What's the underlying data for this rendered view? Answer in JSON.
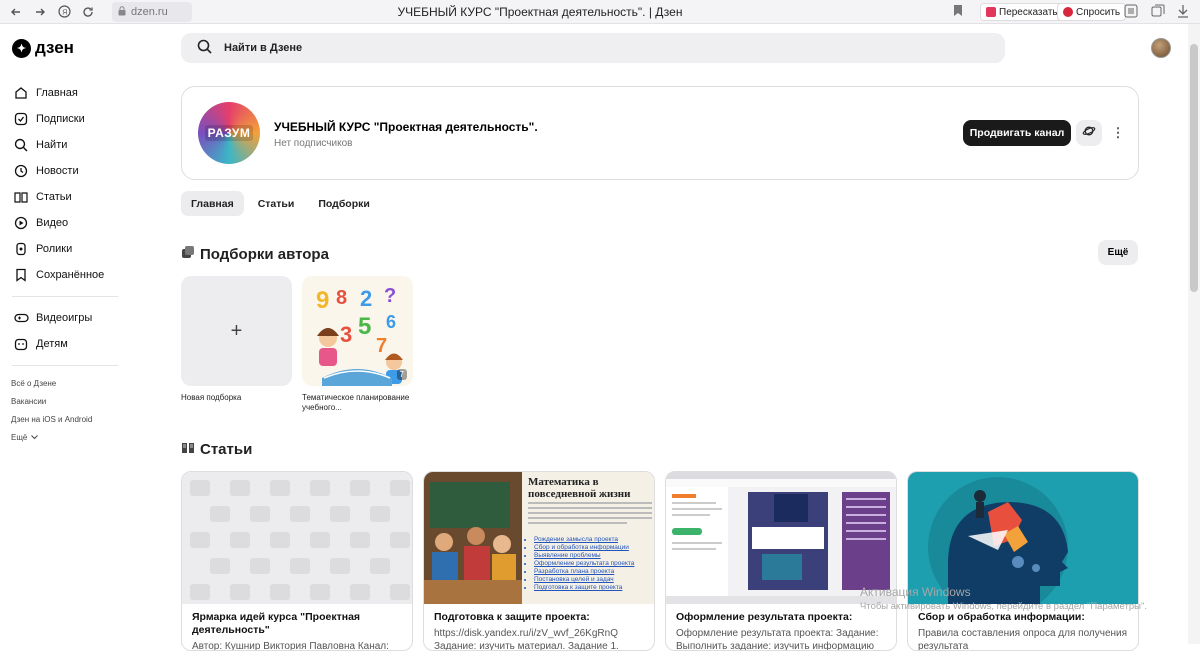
{
  "browser": {
    "url": "dzen.ru",
    "tab_title": "УЧЕБНЫЙ КУРС \"Проектная деятельность\". | Дзен",
    "retell_label": "Пересказать",
    "ask_label": "Спросить"
  },
  "header": {
    "logo_text": "дзен",
    "search_placeholder": "Найти в Дзене"
  },
  "sidebar": {
    "main_items": [
      {
        "label": "Главная",
        "icon": "home-icon"
      },
      {
        "label": "Подписки",
        "icon": "subscriptions-icon"
      },
      {
        "label": "Найти",
        "icon": "search-icon"
      },
      {
        "label": "Новости",
        "icon": "news-icon"
      },
      {
        "label": "Статьи",
        "icon": "articles-icon"
      },
      {
        "label": "Видео",
        "icon": "video-icon"
      },
      {
        "label": "Ролики",
        "icon": "shorts-icon"
      },
      {
        "label": "Сохранённое",
        "icon": "bookmark-icon"
      }
    ],
    "extra_items": [
      {
        "label": "Видеоигры",
        "icon": "gamepad-icon"
      },
      {
        "label": "Детям",
        "icon": "kids-icon"
      }
    ],
    "footer_links": [
      "Всё о Дзене",
      "Вакансии",
      "Дзен на iOS и Android",
      "Ещё"
    ]
  },
  "channel": {
    "avatar_text": "РАЗУМ",
    "title": "УЧЕБНЫЙ КУРС \"Проектная деятельность\".",
    "subscribers": "Нет подписчиков",
    "promote_label": "Продвигать канал"
  },
  "tabs": [
    {
      "label": "Главная",
      "active": true
    },
    {
      "label": "Статьи",
      "active": false
    },
    {
      "label": "Подборки",
      "active": false
    }
  ],
  "collections": {
    "title": "Подборки автора",
    "more_label": "Ещё",
    "new_label": "Новая подборка",
    "items": [
      {
        "label": "Тематическое планирование учебного...",
        "count": "7"
      }
    ]
  },
  "articles": {
    "title": "Статьи",
    "items": [
      {
        "title": "Ярмарка идей курса \"Проектная деятельность\"",
        "desc": "Автор: Кушнир Виктория Павловна Канал:"
      },
      {
        "title": "Подготовка к защите проекта:",
        "desc": "https://disk.yandex.ru/i/zV_wvf_26KgRnQ Задание: изучить материал. Задание 1."
      },
      {
        "title": "Оформление результата проекта:",
        "desc": "Оформление результата проекта: Задание: Выполнить задание: изучить информацию"
      },
      {
        "title": "Сбор и обработка информации:",
        "desc": "Правила составления опроса для получения результата"
      }
    ],
    "math_heading": "Математика в повседневной жизни",
    "math_list": [
      "Рождение замысла проекта",
      "Сбор и обработка информации",
      "Выявление проблемы",
      "Оформление результата проекта",
      "Разработка плана проекта",
      "Постановка целей и задач",
      "Подготовка к защите проекта"
    ]
  },
  "watermark": {
    "line1": "Активация Windows",
    "line2": "Чтобы активировать Windows, перейдите в раздел \"Параметры\"."
  },
  "colors": {
    "accent_dark": "#1a1a1a",
    "pill_bg": "#ededf0",
    "retell_icon": "#e2365b",
    "ask_icon": "#d8263d"
  }
}
